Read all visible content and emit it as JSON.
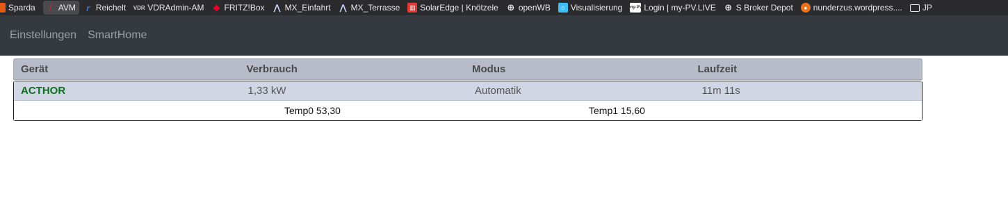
{
  "bookmarks": [
    {
      "label": "Sparda",
      "icon": "sparda-icon",
      "color": "#e35a14"
    },
    {
      "label": "AVM",
      "icon": "avm-icon",
      "color": "#d8202f",
      "active": true
    },
    {
      "label": "Reichelt",
      "icon": "reichelt-icon",
      "color": "#3b74d6"
    },
    {
      "label": "VDRAdmin-AM",
      "icon": "vdradmin-icon",
      "color": "#cfcfcf"
    },
    {
      "label": "FRITZ!Box",
      "icon": "fritzbox-icon",
      "color": "#e4032e"
    },
    {
      "label": "MX_Einfahrt",
      "icon": "mobotix-icon",
      "color": "#c9d3ff"
    },
    {
      "label": "MX_Terrasse",
      "icon": "mobotix-icon",
      "color": "#c9d3ff"
    },
    {
      "label": "SolarEdge | Knötzele",
      "icon": "solaredge-icon",
      "color": "#e53935"
    },
    {
      "label": "openWB",
      "icon": "globe-icon",
      "color": "#e8e8e8"
    },
    {
      "label": "Visualisierung",
      "icon": "home-assistant-icon",
      "color": "#41bdf5"
    },
    {
      "label": "Login | my-PV.LIVE",
      "icon": "mypv-icon",
      "color": "#ffffff"
    },
    {
      "label": "S Broker Depot",
      "icon": "globe-icon",
      "color": "#e8e8e8"
    },
    {
      "label": "nunderzus.wordpress....",
      "icon": "wordpress-icon",
      "color": "#e8731f"
    },
    {
      "label": "JP",
      "icon": "folder-icon",
      "color": "#e8e8e8"
    }
  ],
  "nav": {
    "items": [
      "Einstellungen",
      "SmartHome"
    ]
  },
  "table": {
    "headers": [
      "Gerät",
      "Verbrauch",
      "Modus",
      "Laufzeit"
    ],
    "row": {
      "name": "ACTHOR",
      "verbrauch": "1,33 kW",
      "modus": "Automatik",
      "laufzeit": "11m 11s"
    },
    "temps": [
      "Temp0 53,30",
      "Temp1 15,60"
    ]
  }
}
